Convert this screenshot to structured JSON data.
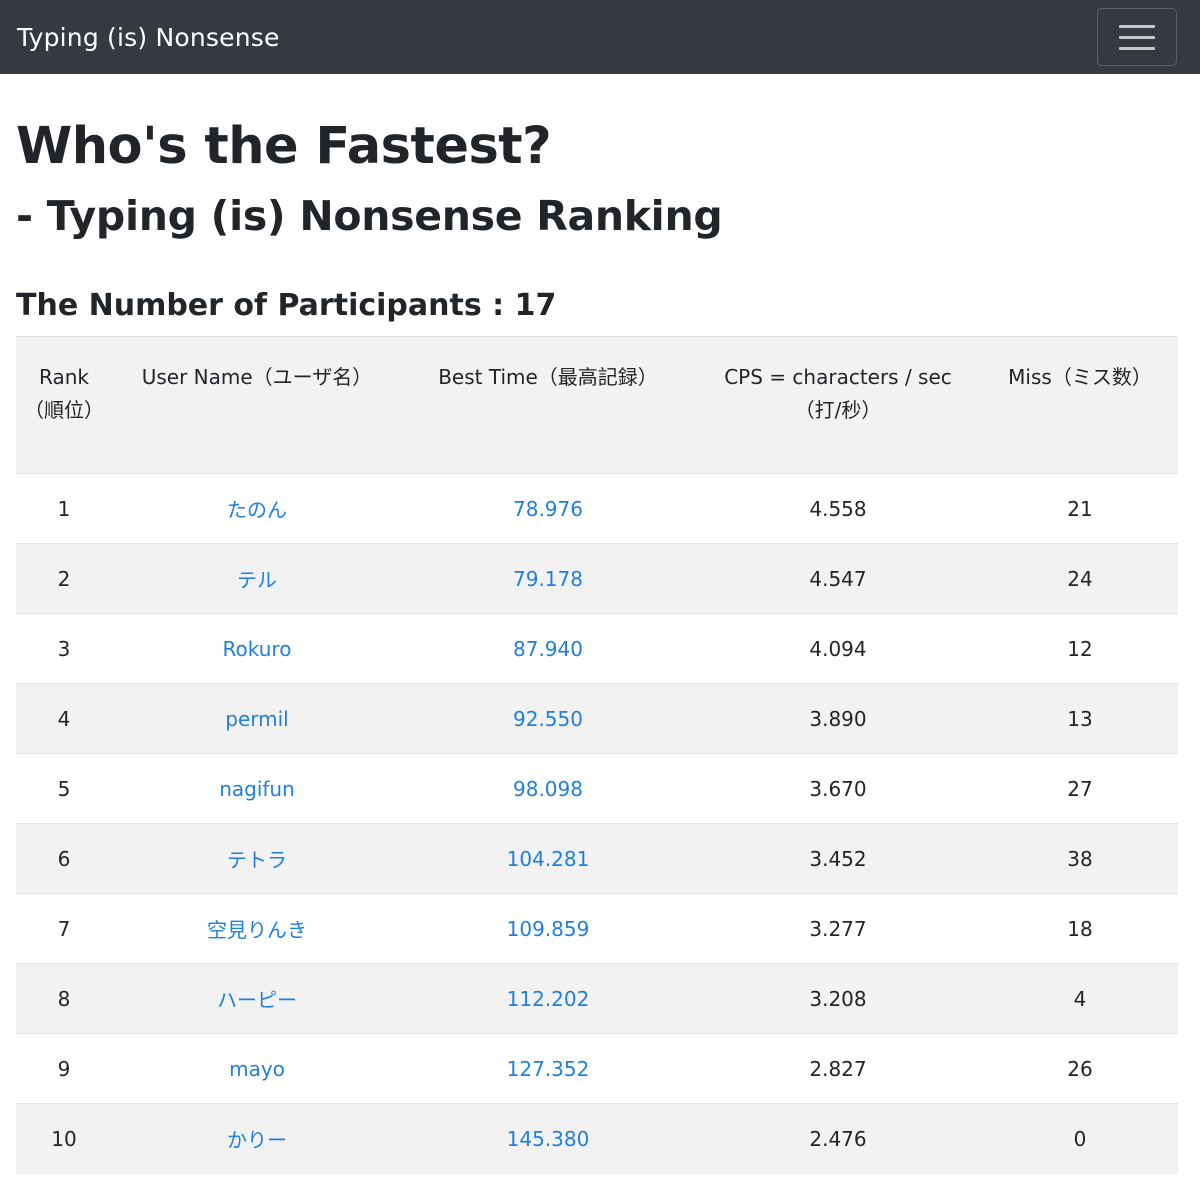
{
  "navbar": {
    "brand": "Typing (is) Nonsense"
  },
  "page": {
    "title": "Who's the Fastest?",
    "subtitle": "- Typing (is) Nonsense Ranking",
    "participants_label": "The Number of Participants : 17"
  },
  "table": {
    "headers": {
      "rank": "Rank（順位）",
      "user": "User Name（ユーザ名）",
      "best": "Best Time（最高記録）",
      "cps": "CPS = characters / sec（打/秒）",
      "miss": "Miss（ミス数）"
    },
    "rows": [
      {
        "rank": "1",
        "user": "たのん",
        "best": "78.976",
        "cps": "4.558",
        "miss": "21"
      },
      {
        "rank": "2",
        "user": "テル",
        "best": "79.178",
        "cps": "4.547",
        "miss": "24"
      },
      {
        "rank": "3",
        "user": "Rokuro",
        "best": "87.940",
        "cps": "4.094",
        "miss": "12"
      },
      {
        "rank": "4",
        "user": "permil",
        "best": "92.550",
        "cps": "3.890",
        "miss": "13"
      },
      {
        "rank": "5",
        "user": "nagifun",
        "best": "98.098",
        "cps": "3.670",
        "miss": "27"
      },
      {
        "rank": "6",
        "user": "テトラ",
        "best": "104.281",
        "cps": "3.452",
        "miss": "38"
      },
      {
        "rank": "7",
        "user": "空見りんき",
        "best": "109.859",
        "cps": "3.277",
        "miss": "18"
      },
      {
        "rank": "8",
        "user": "ハーピー",
        "best": "112.202",
        "cps": "3.208",
        "miss": "4"
      },
      {
        "rank": "9",
        "user": "mayo",
        "best": "127.352",
        "cps": "2.827",
        "miss": "26"
      },
      {
        "rank": "10",
        "user": "かりー",
        "best": "145.380",
        "cps": "2.476",
        "miss": "0"
      }
    ]
  },
  "colors": {
    "navbar_bg": "#343a40",
    "link": "#1f7fe0",
    "stripe": "#f2f2f2"
  },
  "icons": {
    "toggler": "hamburger-menu-icon"
  }
}
